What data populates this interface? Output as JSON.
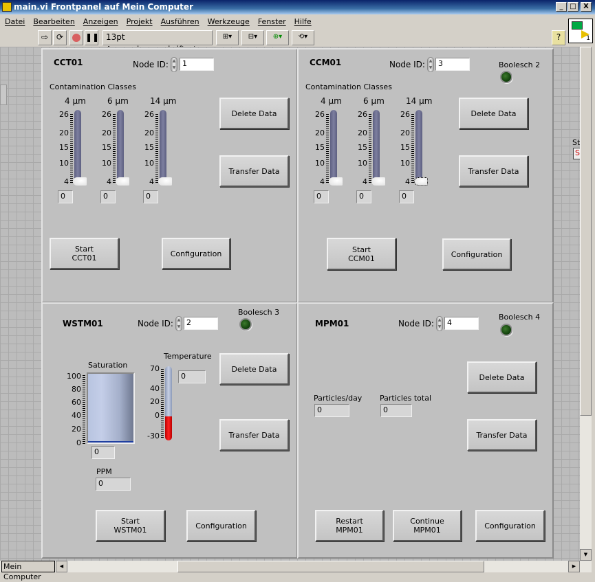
{
  "window": {
    "title": "main.vi Frontpanel auf Mein Computer",
    "minimize": "_",
    "maximize": "□",
    "close": "X"
  },
  "menu": [
    "Datei",
    "Bearbeiten",
    "Anzeigen",
    "Projekt",
    "Ausführen",
    "Werkzeuge",
    "Fenster",
    "Hilfe"
  ],
  "toolbar": {
    "font": "13pt Anwendungsschriftart",
    "help": "?",
    "connector_number": "1"
  },
  "status": {
    "context": "Mein Computer"
  },
  "offscreen": {
    "label": "St",
    "value": "S"
  },
  "cct01": {
    "title": "CCT01",
    "node_label": "Node ID:",
    "node_id": "1",
    "group_label": "Contamination Classes",
    "sliders": [
      {
        "label": "4 µm",
        "value": "0"
      },
      {
        "label": "6 µm",
        "value": "0"
      },
      {
        "label": "14 µm",
        "value": "0"
      }
    ],
    "scale": [
      "26",
      "20",
      "15",
      "10",
      "4"
    ],
    "delete": "Delete Data",
    "transfer": "Transfer Data",
    "start": "Start\nCCT01",
    "config": "Configuration"
  },
  "ccm01": {
    "title": "CCM01",
    "node_label": "Node ID:",
    "node_id": "3",
    "led_label": "Boolesch 2",
    "group_label": "Contamination Classes",
    "sliders": [
      {
        "label": "4 µm",
        "value": "0"
      },
      {
        "label": "6 µm",
        "value": "0"
      },
      {
        "label": "14 µm",
        "value": "0"
      }
    ],
    "scale": [
      "26",
      "20",
      "15",
      "10",
      "4"
    ],
    "delete": "Delete Data",
    "transfer": "Transfer Data",
    "start": "Start\nCCM01",
    "config": "Configuration"
  },
  "wstm01": {
    "title": "WSTM01",
    "node_label": "Node ID:",
    "node_id": "2",
    "led_label": "Boolesch 3",
    "saturation": {
      "label": "Saturation",
      "value": "0",
      "scale": [
        "100",
        "80",
        "60",
        "40",
        "20",
        "0"
      ]
    },
    "temperature": {
      "label": "Temperature",
      "value": "0",
      "scale": [
        "70",
        "40",
        "20",
        "0",
        "-30"
      ]
    },
    "ppm": {
      "label": "PPM",
      "value": "0"
    },
    "delete": "Delete Data",
    "transfer": "Transfer Data",
    "start": "Start\nWSTM01",
    "config": "Configuration"
  },
  "mpm01": {
    "title": "MPM01",
    "node_label": "Node ID:",
    "node_id": "4",
    "led_label": "Boolesch 4",
    "particles_day": {
      "label": "Particles/day",
      "value": "0"
    },
    "particles_total": {
      "label": "Particles total",
      "value": "0"
    },
    "delete": "Delete Data",
    "transfer": "Transfer Data",
    "restart": "Restart\nMPM01",
    "continue": "Continue\nMPM01",
    "config": "Configuration"
  }
}
